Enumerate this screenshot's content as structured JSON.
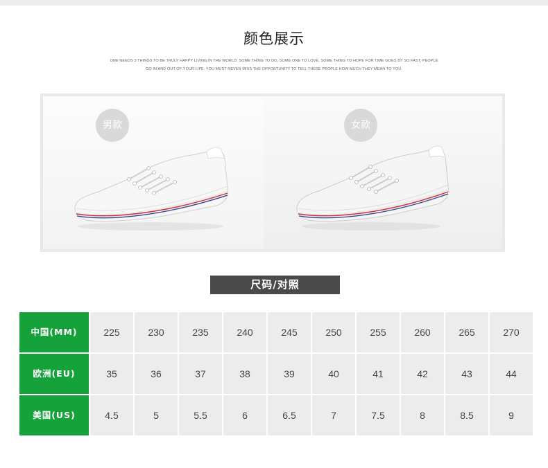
{
  "page": {
    "title": "颜色展示",
    "subtitle_line1": "ONE NEEDS 3 THINGS TO BE TRULY HAPPY LIVING IN THE WORLD: SOME THING TO DO, SOME ONE TO LOVE, SOME THING TO HOPE FOR TIME GOES BY SO FAST, PEOPLE",
    "subtitle_line2": "GO IN AND OUT OF YOUR LIFE. YOU MUST NEVER MISS THE OPPORTUNITY TO TELL THESE PEOPLE HOW MUCH THEY MEAN TO YOU."
  },
  "display": {
    "men_label": "男款",
    "women_label": "女款"
  },
  "size_chart": {
    "title": "尺码/对照",
    "rows": [
      {
        "header": "中国(MM)",
        "values": [
          "225",
          "230",
          "235",
          "240",
          "245",
          "250",
          "255",
          "260",
          "265",
          "270"
        ]
      },
      {
        "header": "欧洲(EU)",
        "values": [
          "35",
          "36",
          "37",
          "38",
          "39",
          "40",
          "41",
          "42",
          "43",
          "44"
        ]
      },
      {
        "header": "美国(US)",
        "values": [
          "4.5",
          "5",
          "5.5",
          "6",
          "6.5",
          "7",
          "7.5",
          "8",
          "8.5",
          "9"
        ]
      }
    ]
  },
  "colors": {
    "header_green": "#16a23a",
    "cell_gray": "#ececec",
    "title_bar": "#4a4a4a",
    "badge_gray": "#d9d9d9"
  }
}
